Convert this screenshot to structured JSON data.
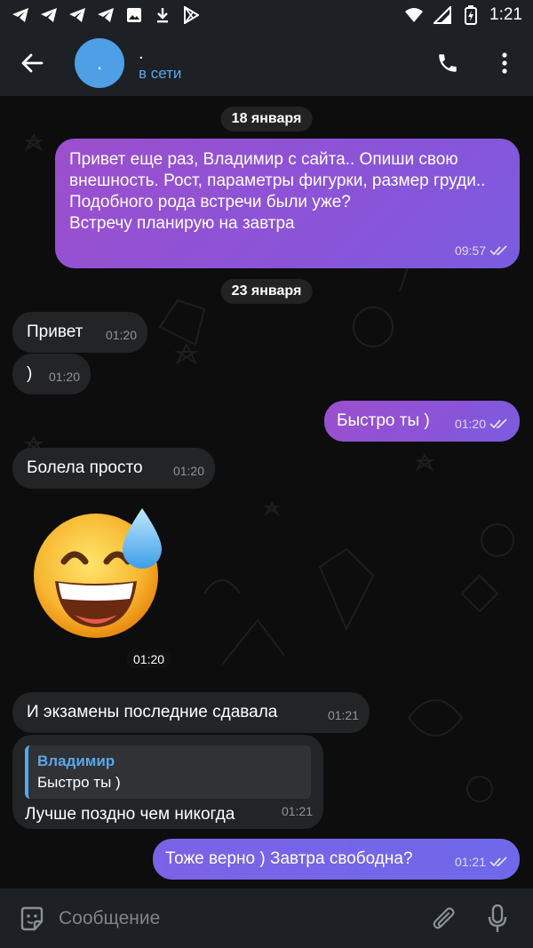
{
  "status_bar": {
    "time": "1:21",
    "left_icons": [
      "telegram-icon",
      "telegram-icon",
      "telegram-icon",
      "telegram-icon",
      "image-icon",
      "download-icon",
      "play-store-icon"
    ],
    "right_icons": [
      "wifi-icon",
      "signal-icon",
      "battery-icon"
    ]
  },
  "header": {
    "avatar_initial": ".",
    "name": ".",
    "status": "в сети"
  },
  "messages": [
    {
      "id": "date1",
      "type": "date",
      "text": "18 января"
    },
    {
      "id": "m1",
      "type": "out",
      "text": "Привет еще раз, Владимир с сайта.. Опиши свою внешность. Рост, параметры фигурки, размер груди..\nПодобного рода встречи были уже?\nВстречу планирую на завтра",
      "time": "09:57"
    },
    {
      "id": "date2",
      "type": "date",
      "text": "23 января"
    },
    {
      "id": "m2",
      "type": "in",
      "text": "Привет",
      "time": "01:20"
    },
    {
      "id": "m3",
      "type": "in",
      "text": ")",
      "time": "01:20"
    },
    {
      "id": "m4",
      "type": "out",
      "text": "Быстро ты )",
      "time": "01:20"
    },
    {
      "id": "m5",
      "type": "in",
      "text": "Болела просто",
      "time": "01:20"
    },
    {
      "id": "m6",
      "type": "sticker",
      "emoji": "grinning-face-with-sweat",
      "time": "01:20"
    },
    {
      "id": "m7",
      "type": "in",
      "text": "И экзамены последние сдавала",
      "time": "01:21"
    },
    {
      "id": "m8",
      "type": "in",
      "reply_name": "Владимир",
      "reply_text": "Быстро ты )",
      "text": "Лучше поздно чем никогда",
      "time": "01:21"
    },
    {
      "id": "m9",
      "type": "out",
      "text": "Тоже верно ) Завтра свободна?",
      "time": "01:21"
    }
  ],
  "input": {
    "placeholder": "Сообщение"
  },
  "colors": {
    "accent": "#5aa7ea",
    "out_bubble": "#9c4fcd",
    "in_bubble": "#222426",
    "bar": "#1d2024"
  }
}
